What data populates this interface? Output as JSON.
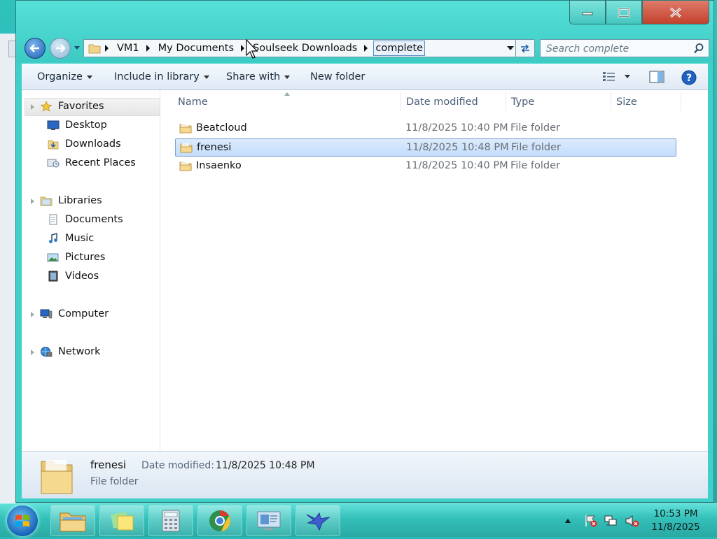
{
  "window": {
    "caption": {
      "minimize": "minimize",
      "maximize": "maximize",
      "close": "close"
    }
  },
  "address_bar": {
    "segments": [
      "VM1",
      "My Documents",
      "Soulseek Downloads",
      "complete"
    ],
    "current": "complete"
  },
  "search": {
    "placeholder": "Search complete"
  },
  "toolbar": {
    "organize": "Organize",
    "include_in_library": "Include in library",
    "share_with": "Share with",
    "new_folder": "New folder"
  },
  "nav": {
    "favorites": {
      "label": "Favorites",
      "items": [
        "Desktop",
        "Downloads",
        "Recent Places"
      ]
    },
    "libraries": {
      "label": "Libraries",
      "items": [
        "Documents",
        "Music",
        "Pictures",
        "Videos"
      ]
    },
    "computer": "Computer",
    "network": "Network"
  },
  "columns": {
    "name": "Name",
    "date": "Date modified",
    "type": "Type",
    "size": "Size"
  },
  "files": [
    {
      "name": "Beatcloud",
      "date": "11/8/2025 10:40 PM",
      "type": "File folder",
      "selected": false
    },
    {
      "name": "frenesi",
      "date": "11/8/2025 10:48 PM",
      "type": "File folder",
      "selected": true
    },
    {
      "name": "Insaenko",
      "date": "11/8/2025 10:40 PM",
      "type": "File folder",
      "selected": false
    }
  ],
  "details": {
    "name": "frenesi",
    "date_label": "Date modified:",
    "date_value": "11/8/2025 10:48 PM",
    "type": "File folder"
  },
  "taskbar": {
    "clock_time": "10:53 PM",
    "clock_date": "11/8/2025",
    "apps": [
      "windows-explorer-icon",
      "sticky-notes-icon",
      "calculator-icon",
      "chrome-icon",
      "remote-desktop-icon",
      "bird-app-icon"
    ]
  },
  "colors": {
    "accent": "#3fd0c9",
    "selection": "#c4ddfb",
    "close": "#c2412c"
  }
}
